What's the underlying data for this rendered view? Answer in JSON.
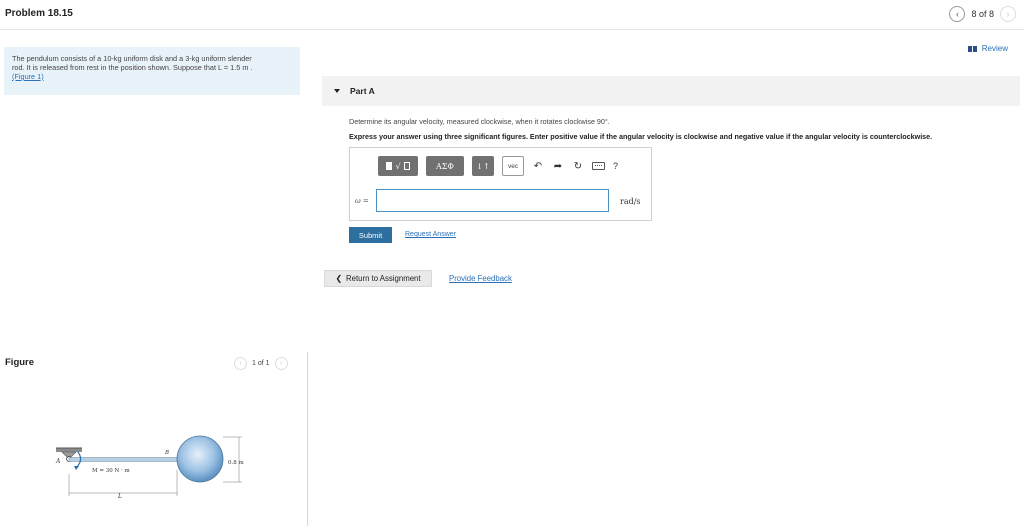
{
  "header": {
    "problem_title": "Problem 18.15",
    "pager_text": "8 of 8",
    "prev_icon": "chevron-left-icon",
    "next_icon": "chevron-right-icon"
  },
  "review": {
    "label": "Review",
    "icon": "review-bars-icon"
  },
  "problem": {
    "line1": "The pendulum consists of a 10-kg uniform disk and a 3-kg uniform slender",
    "line2": "rod. It is released from rest in the position shown. Suppose that L = 1.5 m .",
    "figure_link": "(Figure 1)"
  },
  "figure": {
    "label": "Figure",
    "pager_text": "1 of 1",
    "label_A": "A",
    "label_B": "B",
    "moment_label": "M = 30 N · m",
    "length_label": "L",
    "diameter_label": "0.8 m"
  },
  "part": {
    "title": "Part A",
    "question": "Determine its angular velocity, measured clockwise, when it rotates clockwise 90°.",
    "instruction": "Express your answer using three significant figures. Enter positive value if the angular velocity is clockwise and negative value if the angular velocity is counterclockwise.",
    "variable_label": "ω =",
    "input_value": "",
    "unit": "rad/s",
    "toolbar": {
      "greek_label": "ΑΣΦ",
      "arrows_label": "↓↑",
      "vec_label": "vec",
      "help_label": "?"
    },
    "submit_label": "Submit",
    "request_answer_label": "Request Answer"
  },
  "footer": {
    "return_label": "Return to Assignment",
    "feedback_label": "Provide Feedback"
  }
}
